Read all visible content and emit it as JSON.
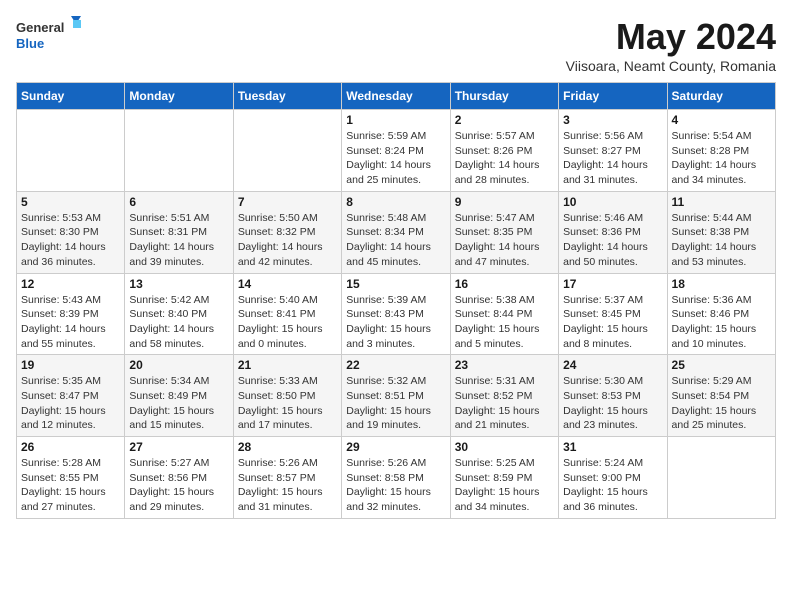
{
  "logo": {
    "general": "General",
    "blue": "Blue"
  },
  "title": "May 2024",
  "subtitle": "Viisoara, Neamt County, Romania",
  "days_of_week": [
    "Sunday",
    "Monday",
    "Tuesday",
    "Wednesday",
    "Thursday",
    "Friday",
    "Saturday"
  ],
  "weeks": [
    [
      {
        "day": "",
        "info": ""
      },
      {
        "day": "",
        "info": ""
      },
      {
        "day": "",
        "info": ""
      },
      {
        "day": "1",
        "info": "Sunrise: 5:59 AM\nSunset: 8:24 PM\nDaylight: 14 hours and 25 minutes."
      },
      {
        "day": "2",
        "info": "Sunrise: 5:57 AM\nSunset: 8:26 PM\nDaylight: 14 hours and 28 minutes."
      },
      {
        "day": "3",
        "info": "Sunrise: 5:56 AM\nSunset: 8:27 PM\nDaylight: 14 hours and 31 minutes."
      },
      {
        "day": "4",
        "info": "Sunrise: 5:54 AM\nSunset: 8:28 PM\nDaylight: 14 hours and 34 minutes."
      }
    ],
    [
      {
        "day": "5",
        "info": "Sunrise: 5:53 AM\nSunset: 8:30 PM\nDaylight: 14 hours and 36 minutes."
      },
      {
        "day": "6",
        "info": "Sunrise: 5:51 AM\nSunset: 8:31 PM\nDaylight: 14 hours and 39 minutes."
      },
      {
        "day": "7",
        "info": "Sunrise: 5:50 AM\nSunset: 8:32 PM\nDaylight: 14 hours and 42 minutes."
      },
      {
        "day": "8",
        "info": "Sunrise: 5:48 AM\nSunset: 8:34 PM\nDaylight: 14 hours and 45 minutes."
      },
      {
        "day": "9",
        "info": "Sunrise: 5:47 AM\nSunset: 8:35 PM\nDaylight: 14 hours and 47 minutes."
      },
      {
        "day": "10",
        "info": "Sunrise: 5:46 AM\nSunset: 8:36 PM\nDaylight: 14 hours and 50 minutes."
      },
      {
        "day": "11",
        "info": "Sunrise: 5:44 AM\nSunset: 8:38 PM\nDaylight: 14 hours and 53 minutes."
      }
    ],
    [
      {
        "day": "12",
        "info": "Sunrise: 5:43 AM\nSunset: 8:39 PM\nDaylight: 14 hours and 55 minutes."
      },
      {
        "day": "13",
        "info": "Sunrise: 5:42 AM\nSunset: 8:40 PM\nDaylight: 14 hours and 58 minutes."
      },
      {
        "day": "14",
        "info": "Sunrise: 5:40 AM\nSunset: 8:41 PM\nDaylight: 15 hours and 0 minutes."
      },
      {
        "day": "15",
        "info": "Sunrise: 5:39 AM\nSunset: 8:43 PM\nDaylight: 15 hours and 3 minutes."
      },
      {
        "day": "16",
        "info": "Sunrise: 5:38 AM\nSunset: 8:44 PM\nDaylight: 15 hours and 5 minutes."
      },
      {
        "day": "17",
        "info": "Sunrise: 5:37 AM\nSunset: 8:45 PM\nDaylight: 15 hours and 8 minutes."
      },
      {
        "day": "18",
        "info": "Sunrise: 5:36 AM\nSunset: 8:46 PM\nDaylight: 15 hours and 10 minutes."
      }
    ],
    [
      {
        "day": "19",
        "info": "Sunrise: 5:35 AM\nSunset: 8:47 PM\nDaylight: 15 hours and 12 minutes."
      },
      {
        "day": "20",
        "info": "Sunrise: 5:34 AM\nSunset: 8:49 PM\nDaylight: 15 hours and 15 minutes."
      },
      {
        "day": "21",
        "info": "Sunrise: 5:33 AM\nSunset: 8:50 PM\nDaylight: 15 hours and 17 minutes."
      },
      {
        "day": "22",
        "info": "Sunrise: 5:32 AM\nSunset: 8:51 PM\nDaylight: 15 hours and 19 minutes."
      },
      {
        "day": "23",
        "info": "Sunrise: 5:31 AM\nSunset: 8:52 PM\nDaylight: 15 hours and 21 minutes."
      },
      {
        "day": "24",
        "info": "Sunrise: 5:30 AM\nSunset: 8:53 PM\nDaylight: 15 hours and 23 minutes."
      },
      {
        "day": "25",
        "info": "Sunrise: 5:29 AM\nSunset: 8:54 PM\nDaylight: 15 hours and 25 minutes."
      }
    ],
    [
      {
        "day": "26",
        "info": "Sunrise: 5:28 AM\nSunset: 8:55 PM\nDaylight: 15 hours and 27 minutes."
      },
      {
        "day": "27",
        "info": "Sunrise: 5:27 AM\nSunset: 8:56 PM\nDaylight: 15 hours and 29 minutes."
      },
      {
        "day": "28",
        "info": "Sunrise: 5:26 AM\nSunset: 8:57 PM\nDaylight: 15 hours and 31 minutes."
      },
      {
        "day": "29",
        "info": "Sunrise: 5:26 AM\nSunset: 8:58 PM\nDaylight: 15 hours and 32 minutes."
      },
      {
        "day": "30",
        "info": "Sunrise: 5:25 AM\nSunset: 8:59 PM\nDaylight: 15 hours and 34 minutes."
      },
      {
        "day": "31",
        "info": "Sunrise: 5:24 AM\nSunset: 9:00 PM\nDaylight: 15 hours and 36 minutes."
      },
      {
        "day": "",
        "info": ""
      }
    ]
  ]
}
